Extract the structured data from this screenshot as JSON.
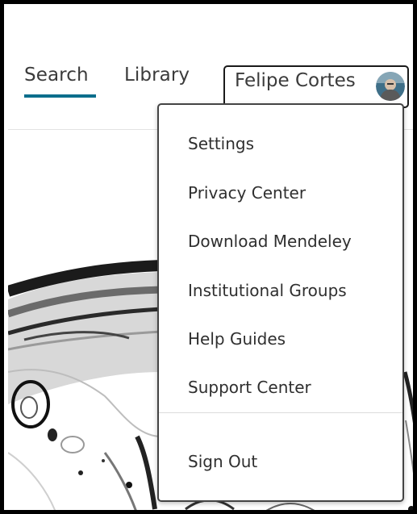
{
  "nav": {
    "search_label": "Search",
    "library_label": "Library",
    "user_name": "Felipe Cortes",
    "accent_color": "#0b6e8c"
  },
  "menu": {
    "items": [
      {
        "label": "Settings"
      },
      {
        "label": "Privacy Center"
      },
      {
        "label": "Download Mendeley"
      },
      {
        "label": "Institutional Groups"
      },
      {
        "label": "Help Guides"
      },
      {
        "label": "Support Center"
      }
    ],
    "sign_out_label": "Sign Out"
  }
}
